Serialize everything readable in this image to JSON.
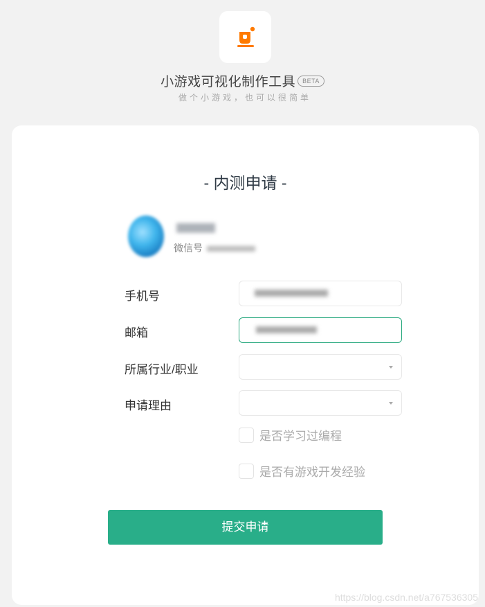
{
  "header": {
    "title": "小游戏可视化制作工具",
    "badge": "BETA",
    "subtitle": "做个小游戏，也可以很简单"
  },
  "form": {
    "title": "- 内测申请 -",
    "wechat_label": "微信号",
    "fields": {
      "phone_label": "手机号",
      "email_label": "邮箱",
      "industry_label": "所属行业/职业",
      "reason_label": "申请理由"
    },
    "checks": {
      "programming": "是否学习过编程",
      "game_dev": "是否有游戏开发经验"
    },
    "submit_label": "提交申请"
  },
  "colors": {
    "accent": "#29ae89",
    "focus_border": "#29a97f",
    "logo_orange": "#ff7a00"
  },
  "watermark": "https://blog.csdn.net/a767536305"
}
